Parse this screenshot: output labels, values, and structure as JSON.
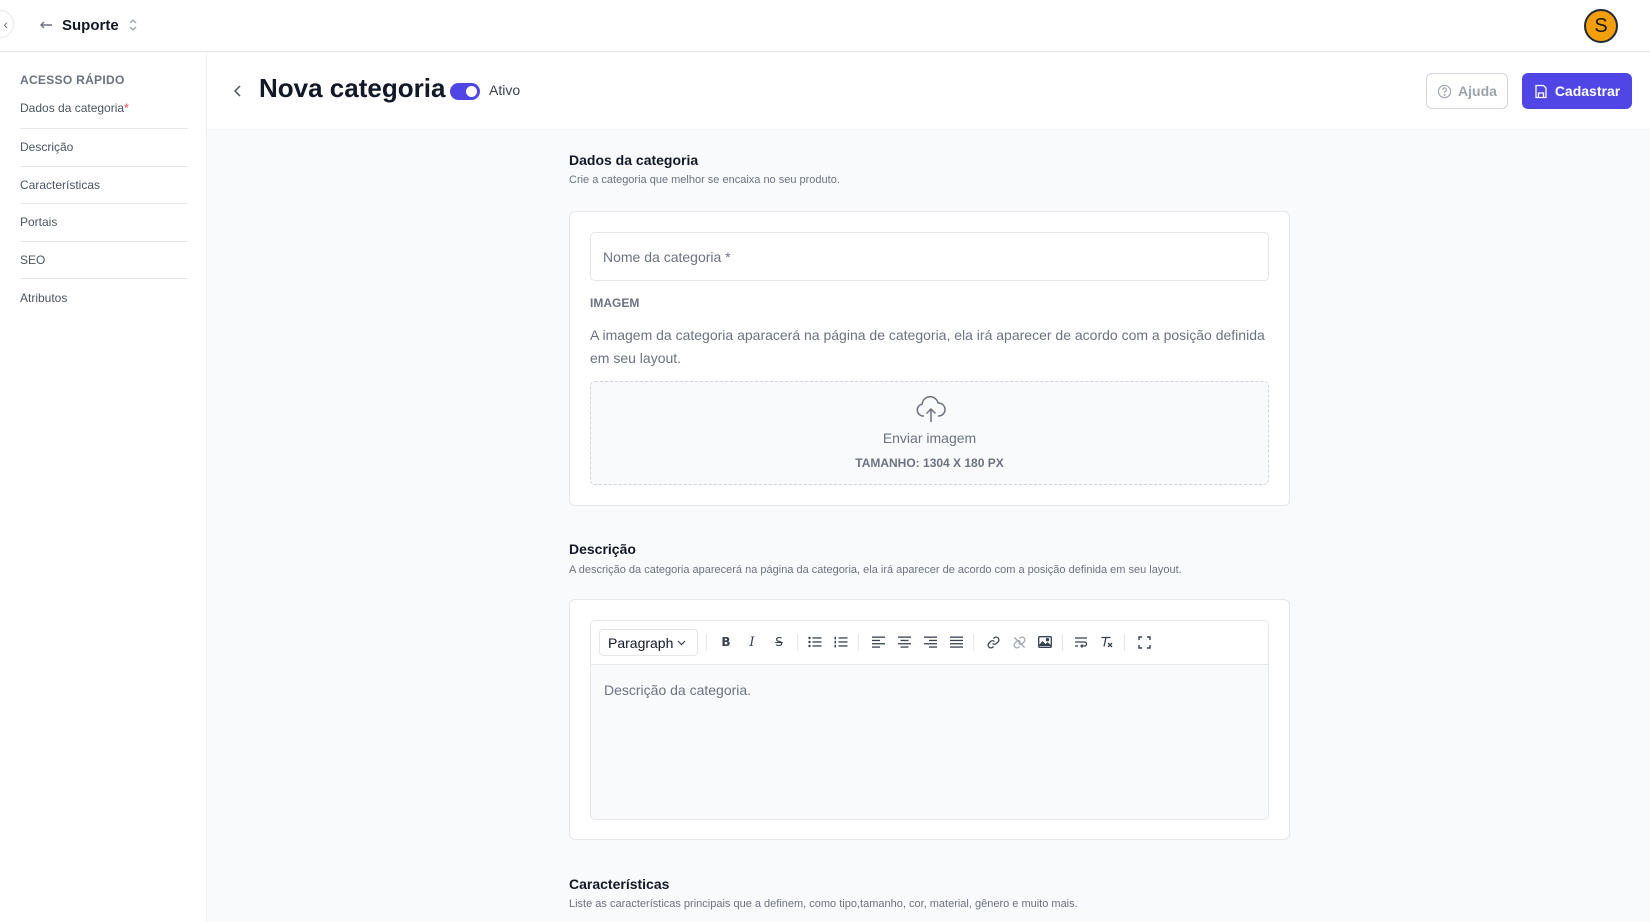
{
  "topbar": {
    "workspace_name": "Suporte",
    "avatar_initial": "S"
  },
  "sidebar": {
    "title": "ACESSO RÁPIDO",
    "items": [
      {
        "label": "Dados da categoria",
        "required_mark": "*"
      },
      {
        "label": "Descrição"
      },
      {
        "label": "Características"
      },
      {
        "label": "Portais"
      },
      {
        "label": "SEO"
      },
      {
        "label": "Atributos"
      }
    ]
  },
  "header": {
    "title": "Nova categoria",
    "status_label": "Ativo",
    "status_active": true,
    "help_label": "Ajuda",
    "submit_label": "Cadastrar",
    "accent_color": "#4f46e5"
  },
  "category_data": {
    "title": "Dados da categoria",
    "subtitle": "Crie a categoria que melhor se encaixa no seu produto.",
    "name_placeholder": "Nome da categoria *",
    "name_value": "",
    "image_label": "IMAGEM",
    "image_description": "A imagem da categoria aparacerá na página de categoria, ela irá aparecer de acordo com a posição definida em seu layout.",
    "upload_label": "Enviar imagem",
    "upload_size": "TAMANHO: 1304 X 180 PX"
  },
  "description": {
    "title": "Descrição",
    "subtitle": "A descrição da categoria aparecerá na página da categoria, ela irá aparecer de acordo com a posição definida em seu layout.",
    "format_value": "Paragraph",
    "placeholder": "Descrição da categoria."
  },
  "characteristics": {
    "title": "Características",
    "subtitle": "Liste as características principais que a definem, como tipo,tamanho, cor, material, gênero e muito mais."
  }
}
